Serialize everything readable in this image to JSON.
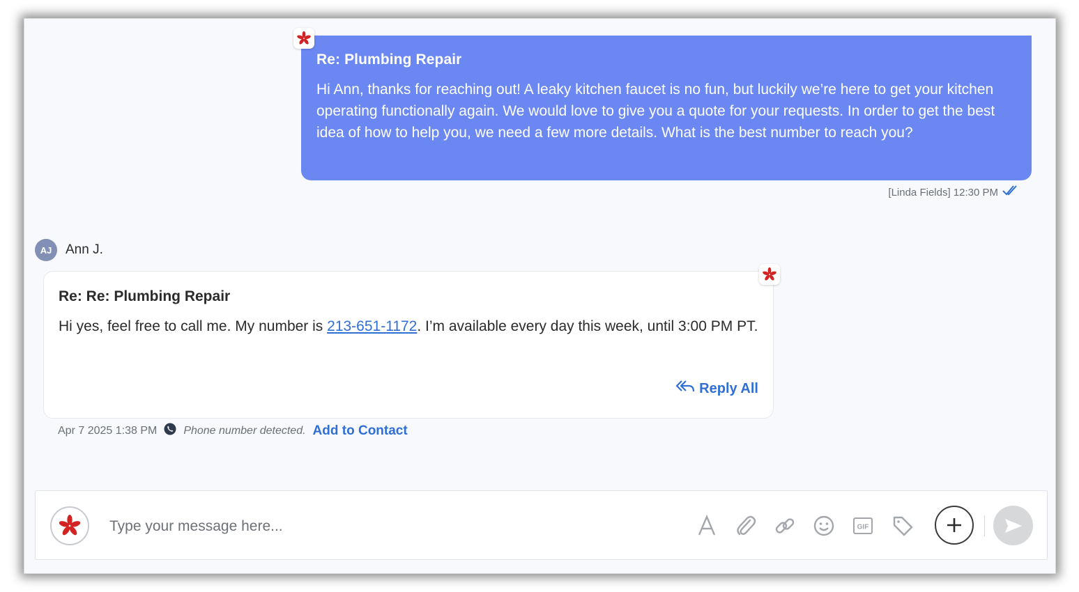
{
  "outgoing": {
    "subject": "Re: Plumbing Repair",
    "body": "Hi Ann, thanks for reaching out! A leaky kitchen faucet is no fun, but luckily we’re here to get your kitchen operating functionally again. We would love to give you a quote for your requests. In order to get the best idea of how to help you, we need a few more details. What is the best number to reach you?",
    "meta": "[Linda Fields] 12:30 PM",
    "status_icon": "double-check-icon"
  },
  "incoming": {
    "avatar_initials": "AJ",
    "sender_name": "Ann J.",
    "subject": "Re: Re: Plumbing Repair",
    "body_before": "Hi yes, feel free to call me. My number is ",
    "phone": "213-651-1172",
    "body_after": ". I’m available every day this week, until 3:00 PM PT.",
    "reply_all_label": "Reply All",
    "timestamp": "Apr 7 2025 1:38 PM",
    "detected_text": "Phone number detected.",
    "add_contact_label": "Add to Contact"
  },
  "composer": {
    "placeholder": "Type your message here...",
    "tools": [
      "text-format-icon",
      "attachment-icon",
      "link-icon",
      "emoji-icon",
      "gif-icon",
      "tag-icon"
    ],
    "gif_label": "GIF"
  },
  "colors": {
    "outgoing_bubble": "#6b87f1",
    "link": "#2f6fd6",
    "yelp_red": "#d32323"
  }
}
